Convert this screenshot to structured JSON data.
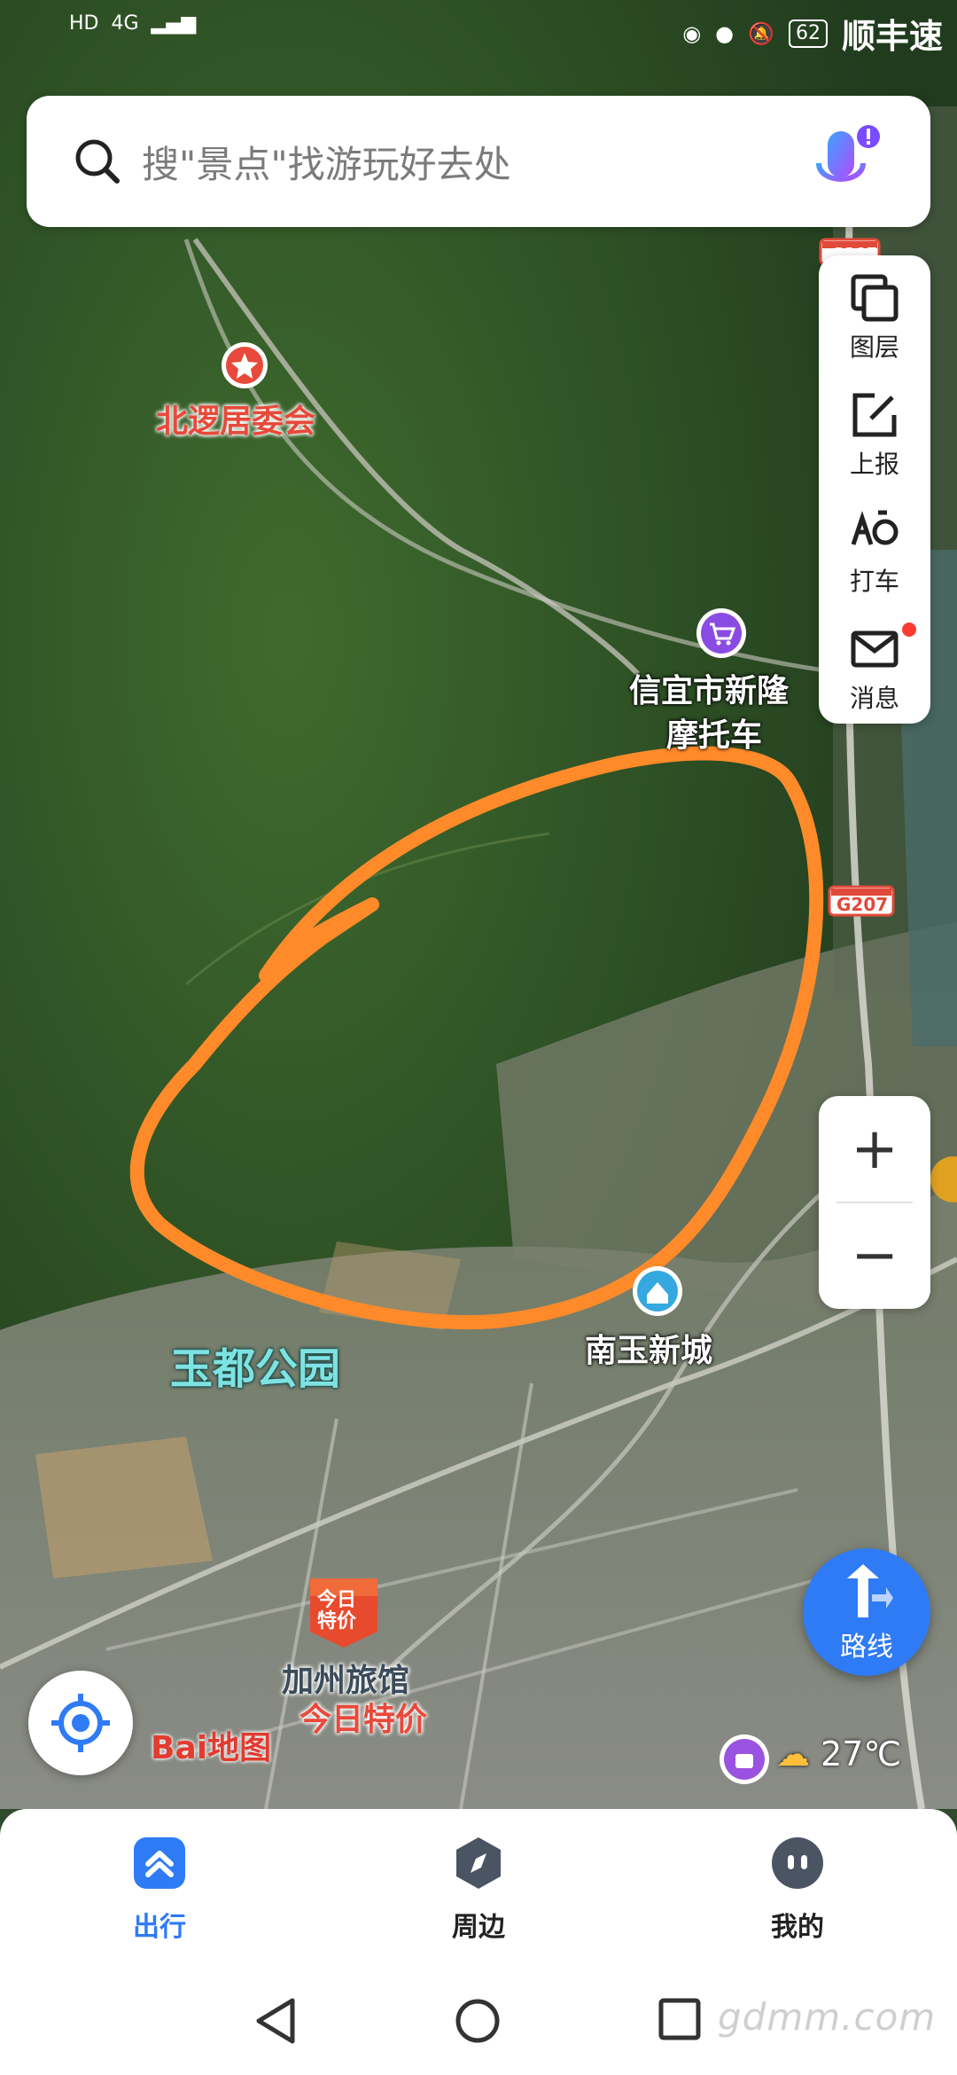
{
  "status_bar": {
    "left_items": [
      "HD",
      "4G"
    ],
    "battery": "62",
    "app_hint": "顺丰速"
  },
  "search": {
    "placeholder": "搜\"景点\"找游玩好去处"
  },
  "toolbar": {
    "items": [
      {
        "label": "图层",
        "icon": "layers-icon"
      },
      {
        "label": "上报",
        "icon": "report-edit-icon"
      },
      {
        "label": "打车",
        "icon": "taxi-icon"
      },
      {
        "label": "消息",
        "icon": "mail-icon"
      }
    ]
  },
  "zoom": {
    "in": "+",
    "out": "−"
  },
  "map": {
    "road_badges": [
      "G207",
      "G207"
    ],
    "labels": {
      "committee": "北逻居委会",
      "shop_line1": "信宜市新隆",
      "shop_line2": "摩托车",
      "new_city": "南玉新城",
      "park": "玉都公园",
      "hotel": "加州旅馆",
      "hotel_promo": "今日特价",
      "promo_badge_line1": "今日",
      "promo_badge_line2": "特价"
    }
  },
  "brand": {
    "logo": "Bai地图"
  },
  "weather": {
    "temp": "27℃"
  },
  "route_button": {
    "label": "路线"
  },
  "bottom_nav": {
    "items": [
      {
        "label": "出行",
        "icon": "travel-icon",
        "active": true
      },
      {
        "label": "周边",
        "icon": "compass-icon",
        "active": false
      },
      {
        "label": "我的",
        "icon": "profile-icon",
        "active": false
      }
    ]
  },
  "watermark": "gdmm.com",
  "colors": {
    "accent": "#2f7bf5",
    "route_stroke": "#ff8a2a",
    "poi_red": "#e8493a"
  }
}
